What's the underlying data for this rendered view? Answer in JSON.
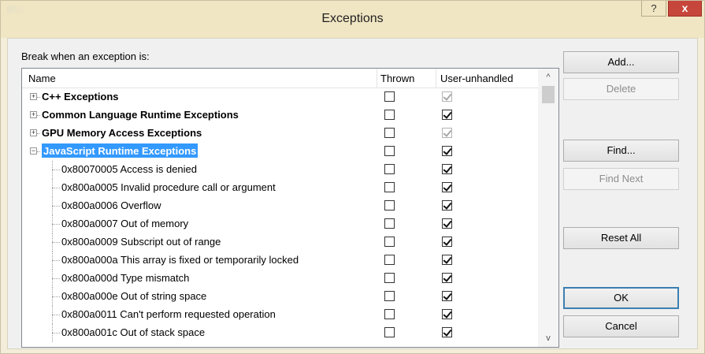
{
  "window": {
    "title": "Exceptions",
    "help_glyph": "?",
    "close_glyph": "x"
  },
  "dialog": {
    "break_label": "Break when an exception is:",
    "columns": {
      "name": "Name",
      "thrown": "Thrown",
      "user_unhandled": "User-unhandled"
    },
    "rows": [
      {
        "label": "C++ Exceptions",
        "level": 0,
        "bold": true,
        "expander": "+",
        "selected": false,
        "thrown": false,
        "user_unhandled": true,
        "user_disabled": true
      },
      {
        "label": "Common Language Runtime Exceptions",
        "level": 0,
        "bold": true,
        "expander": "+",
        "selected": false,
        "thrown": false,
        "user_unhandled": true,
        "user_disabled": false
      },
      {
        "label": "GPU Memory Access Exceptions",
        "level": 0,
        "bold": true,
        "expander": "+",
        "selected": false,
        "thrown": false,
        "user_unhandled": true,
        "user_disabled": true
      },
      {
        "label": "JavaScript Runtime Exceptions",
        "level": 0,
        "bold": true,
        "expander": "−",
        "selected": true,
        "thrown": false,
        "user_unhandled": true,
        "user_disabled": false
      },
      {
        "label": "0x80070005 Access is denied",
        "level": 1,
        "bold": false,
        "thrown": false,
        "user_unhandled": true,
        "user_disabled": false
      },
      {
        "label": "0x800a0005 Invalid procedure call or argument",
        "level": 1,
        "bold": false,
        "thrown": false,
        "user_unhandled": true,
        "user_disabled": false
      },
      {
        "label": "0x800a0006 Overflow",
        "level": 1,
        "bold": false,
        "thrown": false,
        "user_unhandled": true,
        "user_disabled": false
      },
      {
        "label": "0x800a0007 Out of memory",
        "level": 1,
        "bold": false,
        "thrown": false,
        "user_unhandled": true,
        "user_disabled": false
      },
      {
        "label": "0x800a0009 Subscript out of range",
        "level": 1,
        "bold": false,
        "thrown": false,
        "user_unhandled": true,
        "user_disabled": false
      },
      {
        "label": "0x800a000a This array is fixed or temporarily locked",
        "level": 1,
        "bold": false,
        "thrown": false,
        "user_unhandled": true,
        "user_disabled": false
      },
      {
        "label": "0x800a000d Type mismatch",
        "level": 1,
        "bold": false,
        "thrown": false,
        "user_unhandled": true,
        "user_disabled": false
      },
      {
        "label": "0x800a000e Out of string space",
        "level": 1,
        "bold": false,
        "thrown": false,
        "user_unhandled": true,
        "user_disabled": false
      },
      {
        "label": "0x800a0011 Can't perform requested operation",
        "level": 1,
        "bold": false,
        "thrown": false,
        "user_unhandled": true,
        "user_disabled": false
      },
      {
        "label": "0x800a001c Out of stack space",
        "level": 1,
        "bold": false,
        "thrown": false,
        "user_unhandled": true,
        "user_disabled": false
      }
    ],
    "scroll_up_glyph": "^",
    "scroll_down_glyph": "v"
  },
  "buttons": {
    "add": "Add...",
    "delete": "Delete",
    "find": "Find...",
    "find_next": "Find Next",
    "reset_all": "Reset All",
    "ok": "OK",
    "cancel": "Cancel"
  }
}
